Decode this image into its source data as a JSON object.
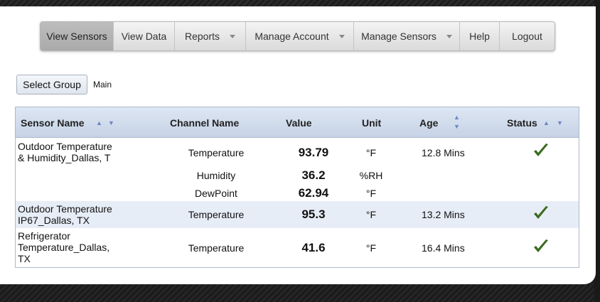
{
  "nav": {
    "items": [
      {
        "label": "View Sensors"
      },
      {
        "label": "View Data"
      },
      {
        "label": "Reports"
      },
      {
        "label": "Manage Account"
      },
      {
        "label": "Manage Sensors"
      },
      {
        "label": "Help"
      },
      {
        "label": "Logout"
      }
    ]
  },
  "group": {
    "button_label": "Select Group",
    "current": "Main"
  },
  "table": {
    "headers": {
      "sensor_name": "Sensor Name",
      "channel_name": "Channel Name",
      "value": "Value",
      "unit": "Unit",
      "age": "Age",
      "status": "Status"
    },
    "sensors": [
      {
        "name": "Outdoor Temperature & Humidity_Dallas, T",
        "name_lines": [
          "Outdoor Temperature",
          "& Humidity_Dallas, T"
        ],
        "age": "12.8 Mins",
        "status": "ok",
        "channels": [
          {
            "channel": "Temperature",
            "value": "93.79",
            "unit": "°F"
          },
          {
            "channel": "Humidity",
            "value": "36.2",
            "unit": "%RH"
          },
          {
            "channel": "DewPoint",
            "value": "62.94",
            "unit": "°F"
          }
        ]
      },
      {
        "name": "Outdoor Temperature IP67_Dallas, TX",
        "name_lines": [
          "Outdoor Temperature",
          "IP67_Dallas, TX"
        ],
        "age": "13.2 Mins",
        "status": "ok",
        "channels": [
          {
            "channel": "Temperature",
            "value": "95.3",
            "unit": "°F"
          }
        ]
      },
      {
        "name": "Refrigerator Temperature_Dallas, TX",
        "name_lines": [
          "Refrigerator",
          "Temperature_Dallas,",
          "TX"
        ],
        "age": "16.4 Mins",
        "status": "ok",
        "channels": [
          {
            "channel": "Temperature",
            "value": "41.6",
            "unit": "°F"
          }
        ]
      }
    ]
  },
  "colors": {
    "check": "#3b6b1f",
    "header_bg": "#c6d3e6",
    "row_alt": "#e7edf6"
  },
  "icons": [
    "sort-up-icon",
    "sort-down-icon",
    "status-ok-check-icon",
    "dropdown-caret-icon"
  ]
}
